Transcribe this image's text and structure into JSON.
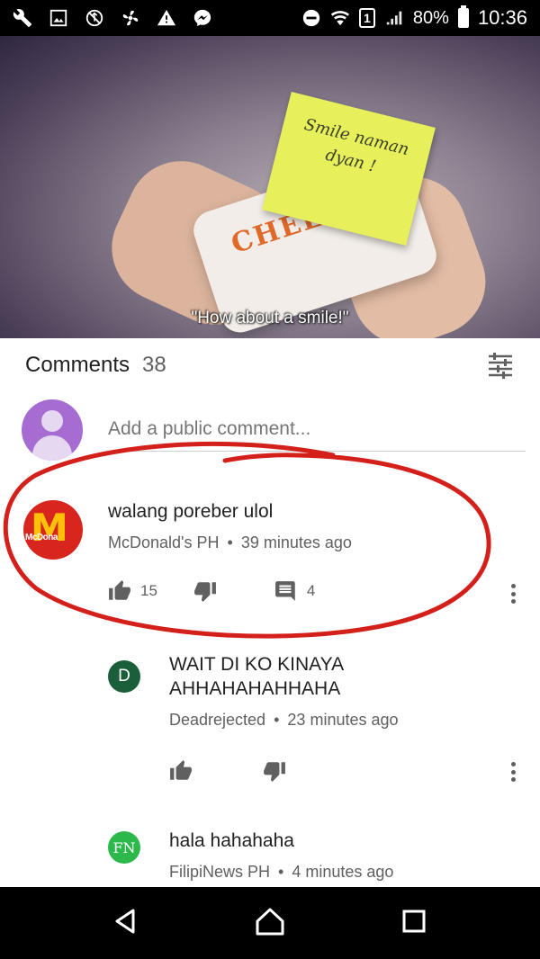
{
  "status_bar": {
    "battery": "80%",
    "time": "10:36",
    "sim_slot": "1",
    "left_icons": [
      "wrench-icon",
      "gallery-icon",
      "usb-blocked-icon",
      "fan-icon",
      "warning-icon",
      "messenger-icon"
    ],
    "right_icons": [
      "do-not-disturb-icon",
      "wifi-icon",
      "sim-icon",
      "signal-icon",
      "battery-icon"
    ]
  },
  "video": {
    "sticky_note": "Smile naman dyan !",
    "wrapper_print": "CHEES",
    "subtitle": "\"How about a smile!\"",
    "progress": 0.28,
    "accent_color": "#e62117"
  },
  "comments_header": {
    "title": "Comments",
    "count": "38"
  },
  "add_comment": {
    "placeholder": "Add a public comment..."
  },
  "comments": [
    {
      "author": "McDonald's PH",
      "avatar_label": "McDona",
      "text": "walang poreber ulol",
      "time": "39 minutes ago",
      "likes": "15",
      "replies": "4"
    },
    {
      "author": "Deadrejected",
      "avatar_letter": "D",
      "avatar_color": "#1b5e3a",
      "text_line1": "WAIT DI KO KINAYA",
      "text_line2": "AHHAHAHAHHAHA",
      "time": "23 minutes ago"
    },
    {
      "author": "FilipiNews PH",
      "avatar_letter": "FN",
      "avatar_color": "#2db84b",
      "text": "hala hahahaha",
      "time": "4 minutes ago"
    }
  ],
  "meta_separator": "•",
  "annotation_color": "#d3201b",
  "nav_bar": {
    "buttons": [
      "back-icon",
      "home-icon",
      "recents-icon"
    ]
  }
}
